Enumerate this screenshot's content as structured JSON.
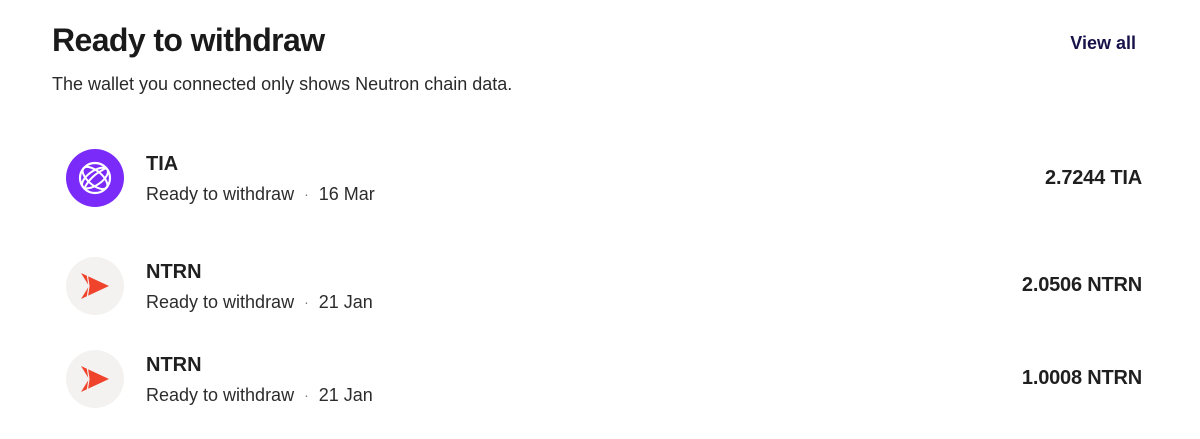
{
  "header": {
    "title": "Ready to withdraw",
    "view_all_label": "View all",
    "subtitle": "The wallet you connected only shows Neutron chain data."
  },
  "withdrawals": [
    {
      "icon": "celestia-logo-icon",
      "symbol": "TIA",
      "status": "Ready to withdraw",
      "separator": "·",
      "date": "16 Mar",
      "amount": "2.7244 TIA"
    },
    {
      "icon": "neutron-logo-icon",
      "symbol": "NTRN",
      "status": "Ready to withdraw",
      "separator": "·",
      "date": "21 Jan",
      "amount": "2.0506 NTRN"
    },
    {
      "icon": "neutron-logo-icon",
      "symbol": "NTRN",
      "status": "Ready to withdraw",
      "separator": "·",
      "date": "21 Jan",
      "amount": "1.0008 NTRN"
    }
  ],
  "colors": {
    "tia_brand": "#7b2bf9",
    "ntrn_brand": "#f0432c",
    "link": "#17134a"
  }
}
